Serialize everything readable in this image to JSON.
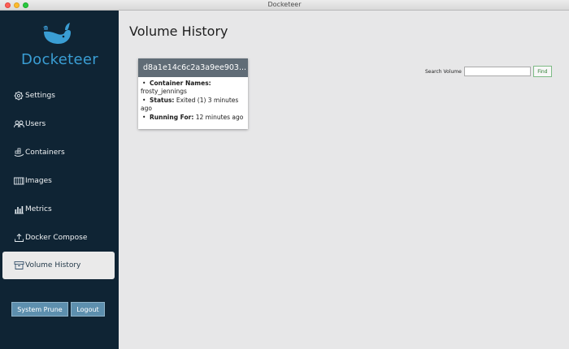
{
  "window": {
    "title": "Docketeer"
  },
  "brand": {
    "name": "Docketeer",
    "color": "#3a9ed4"
  },
  "sidebar": {
    "items": [
      {
        "label": "Settings",
        "icon": "gear-icon"
      },
      {
        "label": "Users",
        "icon": "users-icon"
      },
      {
        "label": "Containers",
        "icon": "containers-icon"
      },
      {
        "label": "Images",
        "icon": "images-icon"
      },
      {
        "label": "Metrics",
        "icon": "metrics-icon"
      },
      {
        "label": "Docker Compose",
        "icon": "upload-icon"
      },
      {
        "label": "Volume History",
        "icon": "archive-icon",
        "active": true
      }
    ],
    "system_prune_label": "System Prune",
    "logout_label": "Logout"
  },
  "main": {
    "title": "Volume History",
    "search": {
      "label": "Search Volume",
      "value": "",
      "button_label": "Find"
    },
    "volumes": [
      {
        "name": "d8a1e14c6c2a3a9ee903...",
        "container_names_label": "Container Names:",
        "container_names": "frosty_jennings",
        "status_label": "Status:",
        "status": "Exited (1) 3 minutes ago",
        "running_for_label": "Running For:",
        "running_for": "12 minutes ago"
      }
    ]
  },
  "colors": {
    "sidebar_bg": "#0f2434",
    "active_item_bg": "#eaeaea",
    "button_bg": "#5d8fae",
    "card_header_bg": "#606c76",
    "find_button_border": "#7dbb85"
  }
}
